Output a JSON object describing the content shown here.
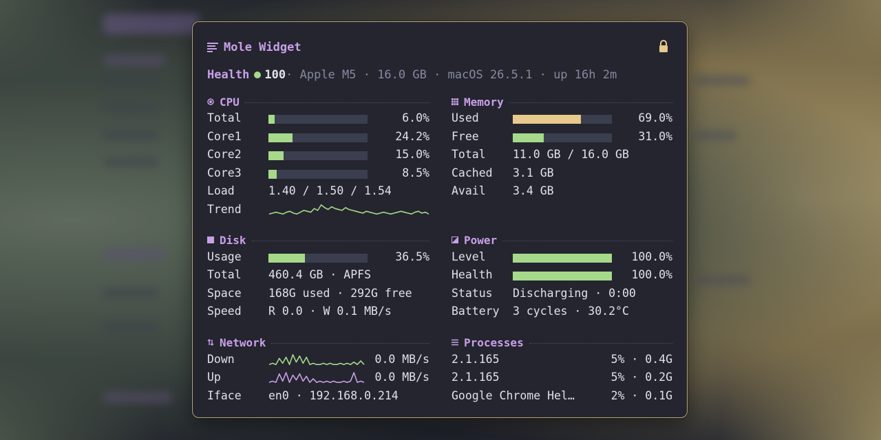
{
  "widget": {
    "title": "Mole Widget",
    "health": {
      "label": "Health",
      "score": "100",
      "meta": " · Apple M5 · 16.0 GB · macOS 26.5.1 · up 16h 2m"
    }
  },
  "cpu": {
    "title": "CPU",
    "rows": [
      {
        "label": "Total",
        "value": "6.0%",
        "level": 0.06
      },
      {
        "label": "Core1",
        "value": "24.2%",
        "level": 0.242
      },
      {
        "label": "Core2",
        "value": "15.0%",
        "level": 0.15
      },
      {
        "label": "Core3",
        "value": "8.5%",
        "level": 0.085
      }
    ],
    "load_label": "Load",
    "load_value": "1.40 / 1.50 / 1.54",
    "trend_label": "Trend",
    "trend": [
      2,
      3,
      4,
      3,
      2,
      4,
      5,
      3,
      2,
      4,
      6,
      5,
      4,
      8,
      6,
      12,
      9,
      7,
      10,
      8,
      7,
      6,
      9,
      7,
      6,
      5,
      4,
      3,
      5,
      4,
      3,
      2,
      3,
      4,
      3,
      2,
      3,
      4,
      5,
      4,
      3,
      2,
      4,
      5,
      3,
      4,
      2
    ]
  },
  "memory": {
    "title": "Memory",
    "used_label": "Used",
    "used_value": "69.0%",
    "used_level": 0.69,
    "free_label": "Free",
    "free_value": "31.0%",
    "free_level": 0.31,
    "total_label": "Total",
    "total_value": "11.0 GB / 16.0 GB",
    "cached_label": "Cached",
    "cached_value": "3.1 GB",
    "avail_label": "Avail",
    "avail_value": "3.4 GB"
  },
  "disk": {
    "title": "Disk",
    "usage_label": "Usage",
    "usage_value": "36.5%",
    "usage_level": 0.365,
    "total_label": "Total",
    "total_value": "460.4 GB · APFS",
    "space_label": "Space",
    "space_value": "168G used · 292G free",
    "speed_label": "Speed",
    "speed_value": "R 0.0 · W 0.1 MB/s"
  },
  "power": {
    "title": "Power",
    "level_label": "Level",
    "level_value": "100.0%",
    "level_level": 1.0,
    "health_label": "Health",
    "health_value": "100.0%",
    "health_level": 1.0,
    "status_label": "Status",
    "status_value": "Discharging · 0:00",
    "battery_label": "Battery",
    "battery_value": "3 cycles · 30.2°C"
  },
  "network": {
    "title": "Network",
    "down_label": "Down",
    "down_value": "0.0 MB/s",
    "down_spark": [
      1,
      2,
      1,
      6,
      2,
      7,
      1,
      9,
      3,
      8,
      2,
      7,
      1,
      2,
      1,
      1,
      2,
      1,
      2,
      1,
      1,
      2,
      1,
      2,
      1,
      3,
      1,
      4,
      1
    ],
    "up_label": "Up",
    "up_value": "0.0 MB/s",
    "up_spark": [
      1,
      2,
      1,
      8,
      2,
      9,
      1,
      7,
      3,
      8,
      2,
      6,
      1,
      4,
      1,
      2,
      1,
      2,
      1,
      2,
      1,
      1,
      2,
      1,
      2,
      9,
      1,
      2,
      1
    ],
    "iface_label": "Iface",
    "iface_value": "en0 · 192.168.0.214"
  },
  "processes": {
    "title": "Processes",
    "items": [
      {
        "name": "2.1.165",
        "stats": "5% · 0.4G"
      },
      {
        "name": "2.1.165",
        "stats": "5% · 0.2G"
      },
      {
        "name": "Google Chrome Hel…",
        "stats": "2% · 0.1G"
      }
    ]
  },
  "colors": {
    "accent": "#c9a0e8",
    "green": "#a6da8a",
    "yellow": "#e8c98c",
    "track": "#3a3e4f",
    "panel": "#24252f"
  }
}
